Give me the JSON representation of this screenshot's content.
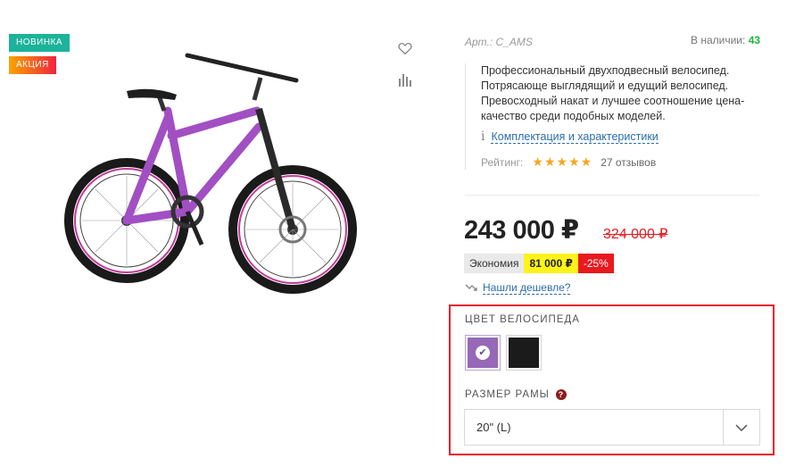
{
  "badges": {
    "new": "Новинка",
    "sale": "Акция"
  },
  "product": {
    "article": "Арт.: C_AMS",
    "stock_label": "В наличии:",
    "stock_count": "43",
    "description": "Профессиональный двухподвесный велосипед. Потрясающе выглядящий и едущий велосипед. Превосходный накат и лучшее соотношение цена-качество среди подобных моделей.",
    "spec_link": "Комплектация и характеристики",
    "rating_label": "Рейтинг:",
    "rating_value": 5,
    "rating_max": 5,
    "reviews": "27 отзывов",
    "image_icon": "bicycle-image"
  },
  "price": {
    "current": "243 000 ₽",
    "old": "324 000 ₽",
    "economy_label": "Экономия",
    "economy_sum": "81 000 ₽",
    "economy_pct": "-25%",
    "cheaper_link": "Нашли дешевле?"
  },
  "options": {
    "color_title": "Цвет велосипеда",
    "colors": [
      {
        "name": "violet",
        "hex": "#9568b8",
        "selected": true
      },
      {
        "name": "black",
        "hex": "#1b1b1b",
        "selected": false
      }
    ],
    "size_title": "Размер рамы",
    "help_glyph": "?",
    "size_value": "20\" (L)"
  },
  "colors": {
    "accent_link": "#2a6dab",
    "stock": "#1cb43c",
    "sale_red": "#e51b24",
    "highlight": "#e8192c"
  }
}
